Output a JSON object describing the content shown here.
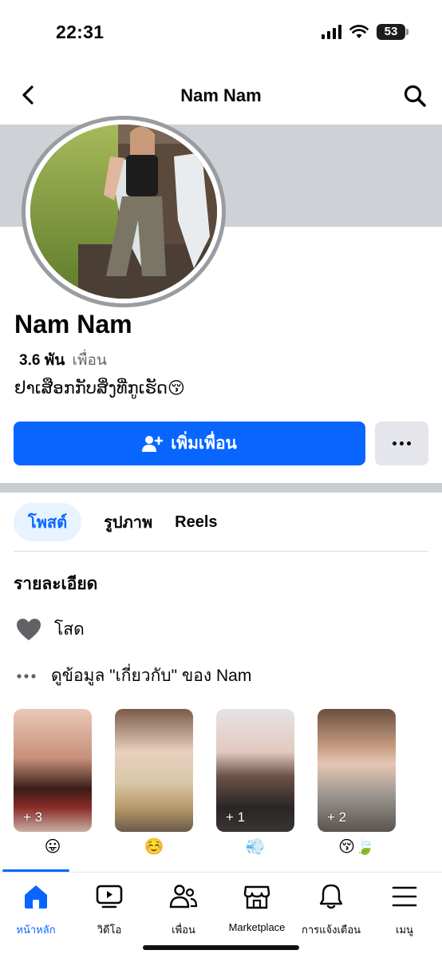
{
  "status_bar": {
    "time": "22:31",
    "battery": "53"
  },
  "header": {
    "title": "Nam Nam"
  },
  "profile": {
    "name": "Nam Nam",
    "friends_count": "3.6 พัน",
    "friends_label": "เพื่อน",
    "bio": "ຢາເສືອກກັບສິ່ງທີ່ກູເຮັດ😚"
  },
  "actions": {
    "add_friend_label": "เพิ่มเพื่อน"
  },
  "tabs": [
    {
      "label": "โพสต์",
      "active": true
    },
    {
      "label": "รูปภาพ",
      "active": false
    },
    {
      "label": "Reels",
      "active": false
    }
  ],
  "details": {
    "title": "รายละเอียด",
    "relationship": "โสด",
    "about_link": "ดูข้อมูล \"เกี่ยวกับ\" ของ Nam"
  },
  "highlights": [
    {
      "count": "+ 3",
      "emoji": "😛"
    },
    {
      "count": "",
      "emoji": "☺️"
    },
    {
      "count": "+ 1",
      "emoji": "💨"
    },
    {
      "count": "+ 2",
      "emoji": "😚🍃"
    }
  ],
  "bottom_nav": [
    {
      "label": "หน้าหลัก",
      "icon": "home-icon",
      "active": true
    },
    {
      "label": "วิดีโอ",
      "icon": "video-icon",
      "active": false
    },
    {
      "label": "เพื่อน",
      "icon": "friends-icon",
      "active": false
    },
    {
      "label": "Marketplace",
      "icon": "marketplace-icon",
      "active": false
    },
    {
      "label": "การแจ้งเตือน",
      "icon": "bell-icon",
      "active": false
    },
    {
      "label": "เมนู",
      "icon": "menu-icon",
      "active": false
    }
  ],
  "colors": {
    "accent": "#0866ff",
    "button_secondary": "#e4e6eb",
    "cover": "#ced1d6"
  }
}
